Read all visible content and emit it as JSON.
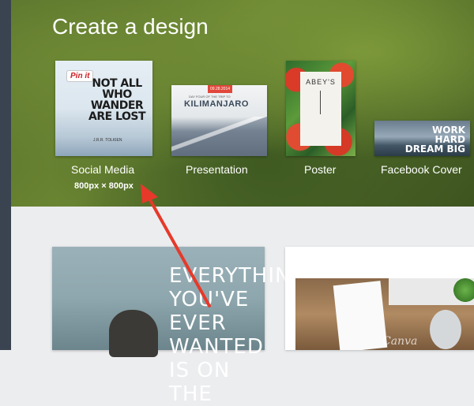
{
  "hero": {
    "title": "Create a design"
  },
  "designs": [
    {
      "label": "Social Media",
      "size": "800px × 800px",
      "thumb": {
        "badge": "Pin it",
        "quote": "NOT ALL WHO WANDER ARE LOST",
        "author": "J.R.R. TOLKIEN"
      }
    },
    {
      "label": "Presentation",
      "thumb": {
        "date": "09.28.2014",
        "subtitle": "DAY FOUR OF THE TRIP TO",
        "title": "KILIMANJARO"
      }
    },
    {
      "label": "Poster",
      "thumb": {
        "name": "ABEY'S"
      }
    },
    {
      "label": "Facebook Cover",
      "thumb": {
        "text": "WORK HARD DREAM BIG"
      }
    }
  ],
  "templates": {
    "card1_text": "EVERYTHING YOU'VE EVER WANTED IS ON THE",
    "card2_watermark": "Canva"
  },
  "colors": {
    "sidebar": "#3a4350",
    "arrow": "#e6392a",
    "pin_red": "#cb2027"
  }
}
